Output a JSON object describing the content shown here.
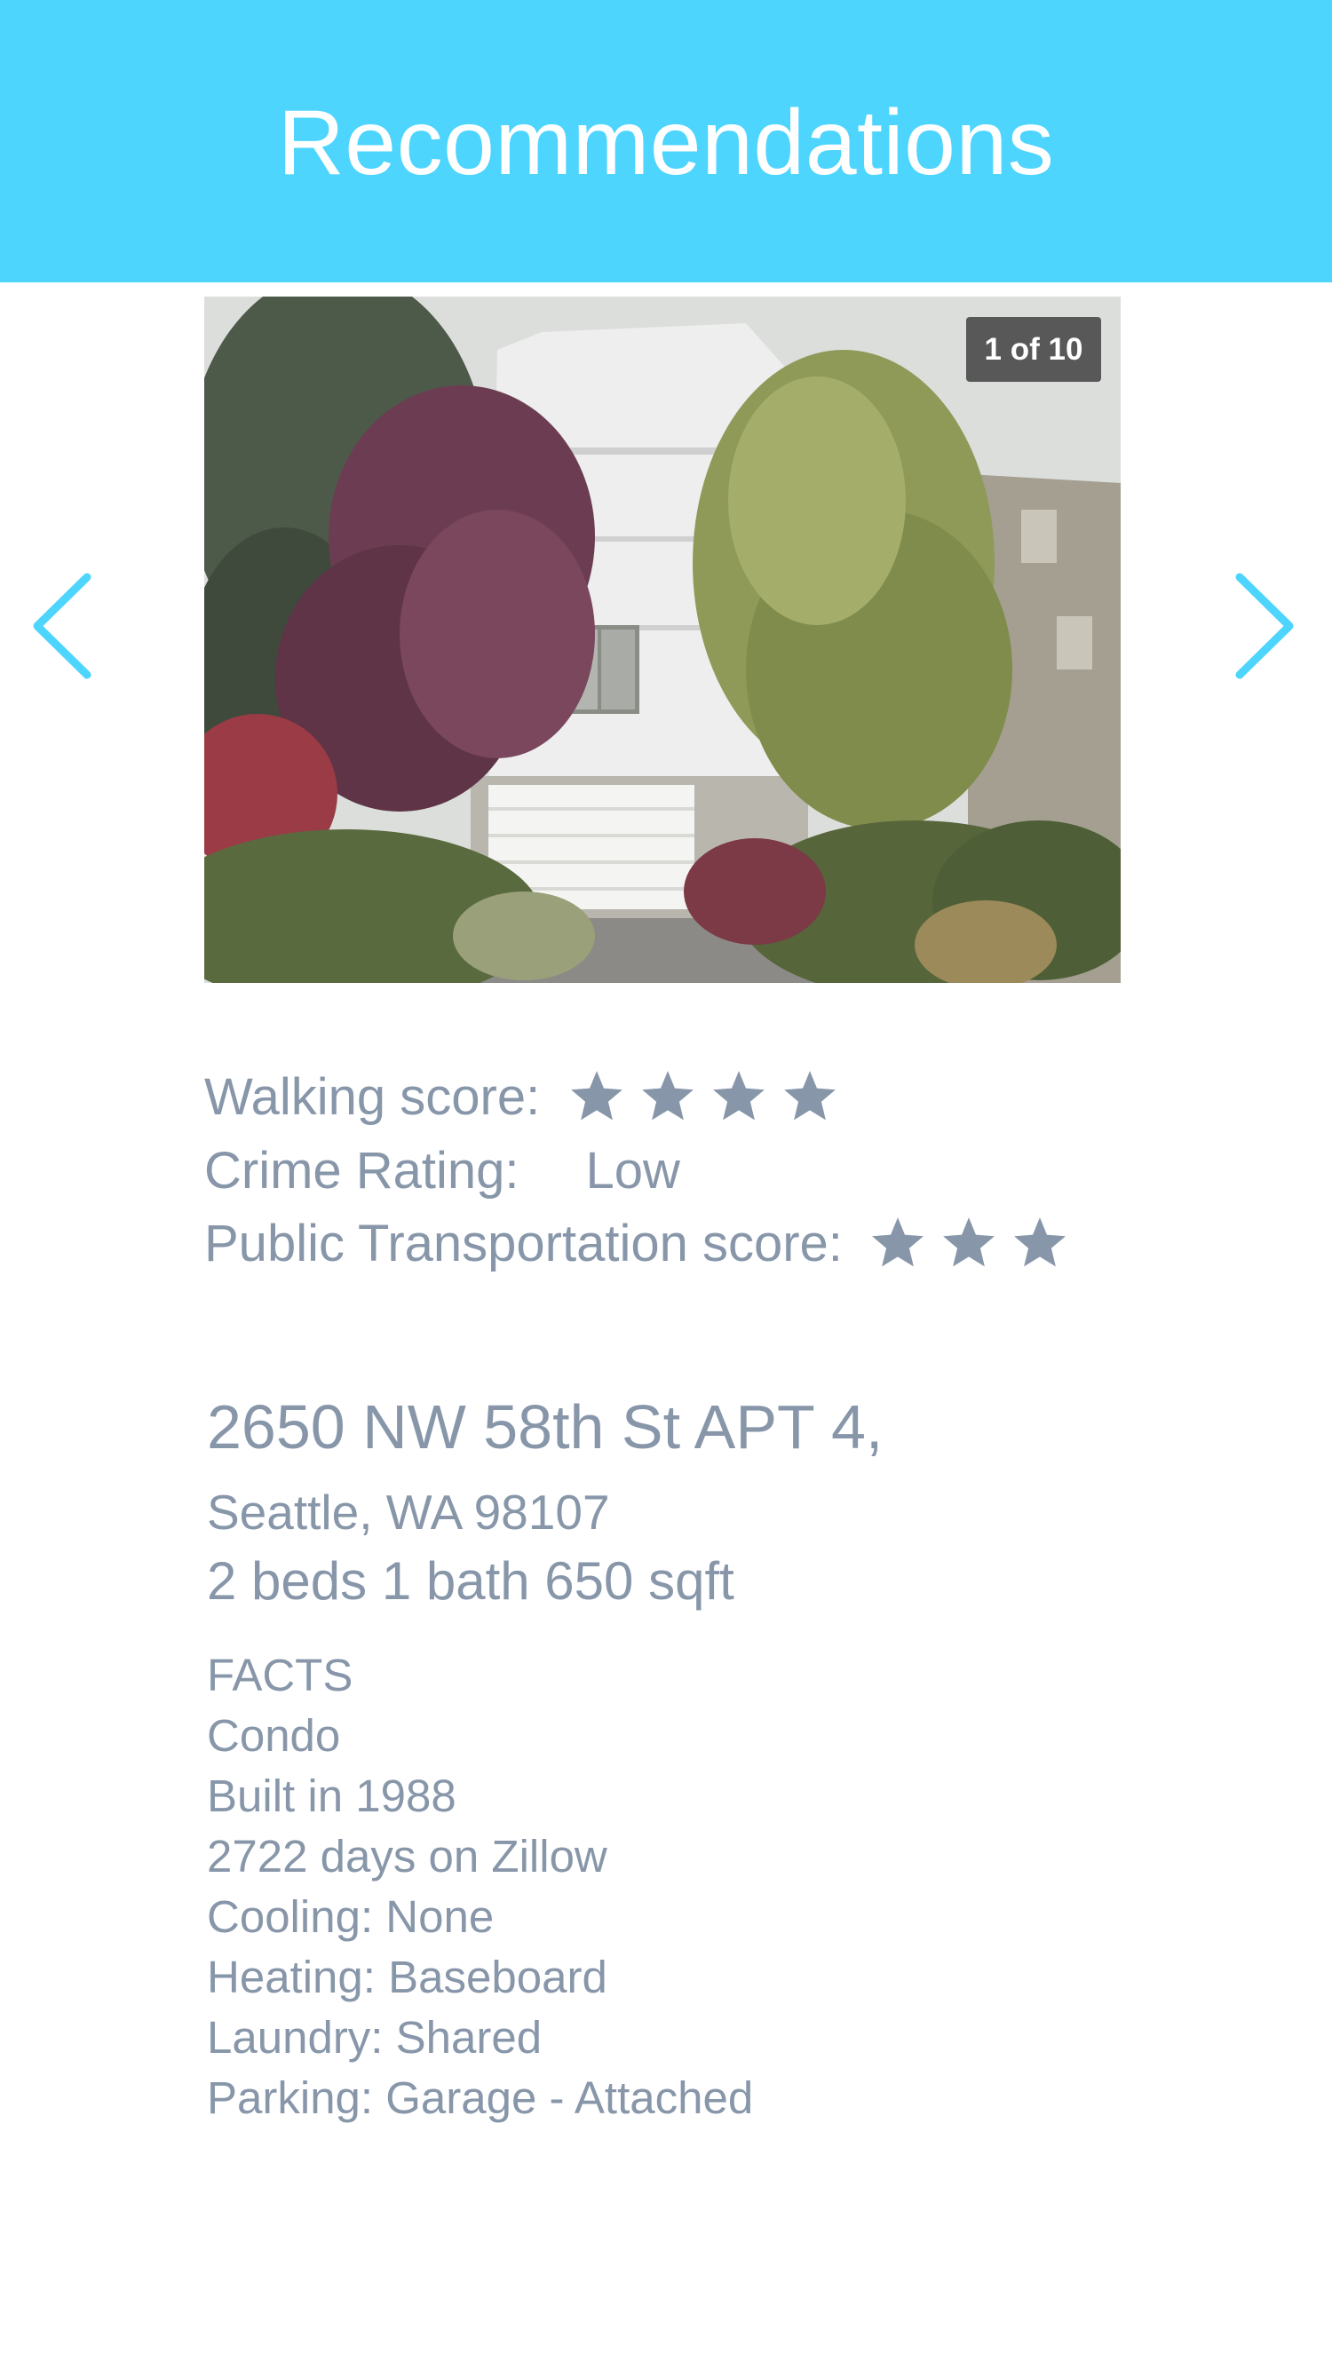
{
  "header": {
    "title": "Recommendations"
  },
  "nav": {
    "prev_icon": "chevron-left-icon",
    "next_icon": "chevron-right-icon",
    "color": "#4dd5fd"
  },
  "photo": {
    "counter": "1 of 10"
  },
  "scores": {
    "walking": {
      "label": "Walking score:",
      "stars": 4
    },
    "crime": {
      "label": "Crime Rating:",
      "value": "Low"
    },
    "transit": {
      "label": "Public Transportation score:",
      "stars": 3
    }
  },
  "listing": {
    "address_line1": "2650 NW 58th St APT 4,",
    "address_line2": "Seattle, WA 98107",
    "summary": "2 beds 1 bath 650 sqft"
  },
  "facts": [
    "FACTS",
    "Condo",
    "Built in 1988",
    "2722 days on Zillow",
    "Cooling: None",
    "Heating: Baseboard",
    "Laundry: Shared",
    "Parking: Garage - Attached"
  ],
  "colors": {
    "header_bg": "#4dd5fd",
    "text": "#8796a9",
    "star": "#8796a9"
  }
}
